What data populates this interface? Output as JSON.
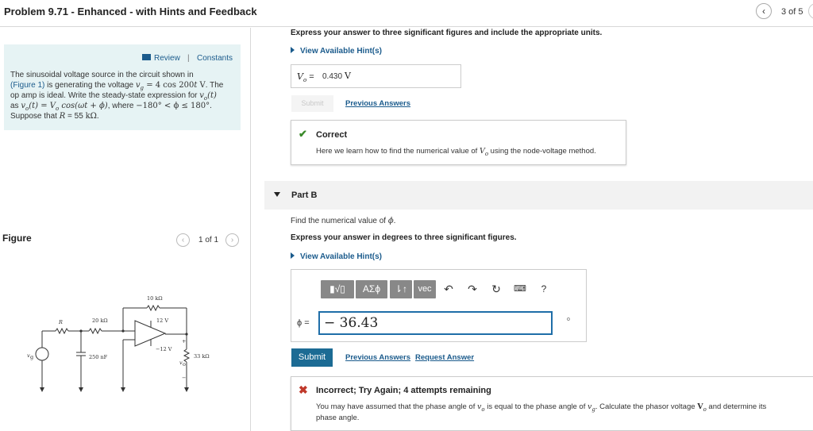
{
  "header": {
    "title": "Problem 9.71 - Enhanced - with Hints and Feedback",
    "prev_icon": "chevron-left-icon",
    "prev_glyph": "‹",
    "page_count": "3 of 5"
  },
  "info": {
    "review": "Review",
    "separator": "|",
    "constants": "Constants",
    "line1": "The sinusoidal voltage source in the circuit shown in",
    "figure_link": "(Figure 1)",
    "line2_rest": " is generating the voltage ",
    "line2_vg": "v",
    "line2_vg_sub": "g",
    "line2_eq": " = 4 cos 200",
    "line2_t": "t",
    "line2_unit": " V",
    "line2_end": ". The",
    "line3_a": "op amp is ideal. Write the steady-state expression for ",
    "line3_vo": "v",
    "line3_vo_sub": "o",
    "line3_t": "(t)",
    "line4_a": "as ",
    "line4_eq": "v",
    "line4_eq_sub": "o",
    "line4_eq_b": "(t) = ",
    "line4_V": "V",
    "line4_V_sub": "o",
    "line4_cos": " cos(ωt + ϕ)",
    "line4_where": ", where ",
    "line4_range": "−180° < ϕ ≤ 180°",
    "line4_end": ".",
    "line5_a": "Suppose that ",
    "line5_R": "R",
    "line5_b": " = 55 ",
    "line5_unit": "kΩ",
    "line5_end": "."
  },
  "figure": {
    "label": "Figure",
    "prev_glyph": "‹",
    "count": "1 of 1",
    "next_glyph": "›",
    "circuit_labels": {
      "r_top": "10 kΩ",
      "r_label": "R",
      "r_mid": "20 kΩ",
      "vpos": "12 V",
      "vneg": "−12 V",
      "cap": "250 nF",
      "vg": "v",
      "vg_sub": "g",
      "vo": "v",
      "vo_sub": "o",
      "r_load": "33 kΩ",
      "plus": "+",
      "minus": "−"
    }
  },
  "part_a": {
    "instruction": "Express your answer to three significant figures and include the appropriate units.",
    "hints": "View Available Hint(s)",
    "answer_label": "V",
    "answer_label_sub": "o",
    "answer_eq": " = ",
    "answer_value": "0.430",
    "answer_unit": "V",
    "submit": "Submit",
    "previous_answers": "Previous Answers",
    "correct_title": "Correct",
    "correct_text_a": "Here we learn how to find the numerical value of ",
    "correct_text_V": "V",
    "correct_text_V_sub": "o",
    "correct_text_b": " using the node-voltage method."
  },
  "part_b": {
    "title": "Part B",
    "question_a": "Find the numerical value of ",
    "question_phi": "ϕ",
    "question_end": ".",
    "instruction": "Express your answer in degrees to three significant figures.",
    "hints": "View Available Hint(s)",
    "toolbar": {
      "templates": "▮√▯",
      "greek": "ΑΣϕ",
      "updown": "⇂↑",
      "vec": "vec",
      "undo_icon": "undo-icon",
      "redo_icon": "redo-icon",
      "reset_icon": "reset-icon",
      "keyboard_icon": "keyboard-icon",
      "help": "?"
    },
    "phi_label": "ϕ =",
    "phi_value": "− 36.43",
    "deg_mark": "o",
    "submit": "Submit",
    "previous_answers": "Previous Answers",
    "request_answer": "Request Answer",
    "incorrect_title": "Incorrect; Try Again; 4 attempts remaining",
    "incorrect_1a": "You may have assumed that the phase angle of ",
    "incorrect_1_vo": "v",
    "incorrect_1_vo_sub": "o",
    "incorrect_1b": " is equal to the phase angle of ",
    "incorrect_1_vg": "v",
    "incorrect_1_vg_sub": "g",
    "incorrect_1c": ". Calculate the phasor voltage ",
    "incorrect_1_V": "V",
    "incorrect_1_V_sub": "o",
    "incorrect_1d": " and determine its",
    "incorrect_2": "phase angle."
  },
  "colors": {
    "link": "#1b5b8c",
    "info_bg": "#e6f3f4",
    "submit_active": "#1c6b94",
    "correct": "#3a8a2a",
    "incorrect": "#c0392b",
    "input_focus": "#1f6ea8"
  }
}
